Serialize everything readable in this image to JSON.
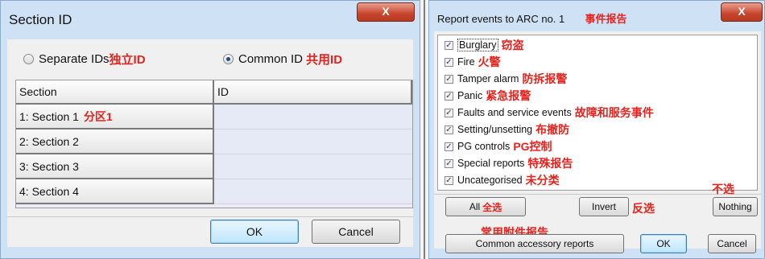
{
  "left_window": {
    "title": "Section ID",
    "close_label": "X",
    "options": [
      {
        "label": "Separate IDs",
        "cn": "独立ID",
        "selected": false
      },
      {
        "label": "Common ID",
        "cn": "共用ID",
        "selected": true
      }
    ],
    "table": {
      "headers": [
        "Section",
        "ID"
      ],
      "rows": [
        {
          "section": "1: Section 1",
          "cn": "分区1",
          "id": ""
        },
        {
          "section": "2: Section 2",
          "cn": "",
          "id": ""
        },
        {
          "section": "3: Section 3",
          "cn": "",
          "id": ""
        },
        {
          "section": "4: Section 4",
          "cn": "",
          "id": ""
        }
      ]
    },
    "buttons": {
      "ok": "OK",
      "cancel": "Cancel"
    }
  },
  "right_window": {
    "title": "Report events to ARC no. 1",
    "title_cn": "事件报告",
    "close_label": "X",
    "events": [
      {
        "label": "Burglary",
        "cn": "窃盗",
        "checked": true
      },
      {
        "label": "Fire",
        "cn": "火警",
        "checked": true
      },
      {
        "label": "Tamper alarm",
        "cn": "防拆报警",
        "checked": true
      },
      {
        "label": "Panic",
        "cn": "紧急报警",
        "checked": true
      },
      {
        "label": "Faults and service events",
        "cn": "故障和服务事件",
        "checked": true
      },
      {
        "label": "Setting/unsetting",
        "cn": "布撤防",
        "checked": true
      },
      {
        "label": "PG controls",
        "cn": "PG控制",
        "checked": true
      },
      {
        "label": "Special reports",
        "cn": "特殊报告",
        "checked": true
      },
      {
        "label": "Uncategorised",
        "cn": "未分类",
        "checked": true
      }
    ],
    "buttons": {
      "all": "All",
      "all_cn": "全选",
      "invert": "Invert",
      "invert_cn": "反选",
      "nothing": "Nothing",
      "nothing_cn": "不选",
      "common": "Common accessory reports",
      "common_cn": "常用附件报告",
      "ok": "OK",
      "cancel": "Cancel"
    }
  },
  "colors": {
    "annotation": "#e5231e",
    "frame": "#cfe2f5",
    "client": "#f0f0f0"
  }
}
